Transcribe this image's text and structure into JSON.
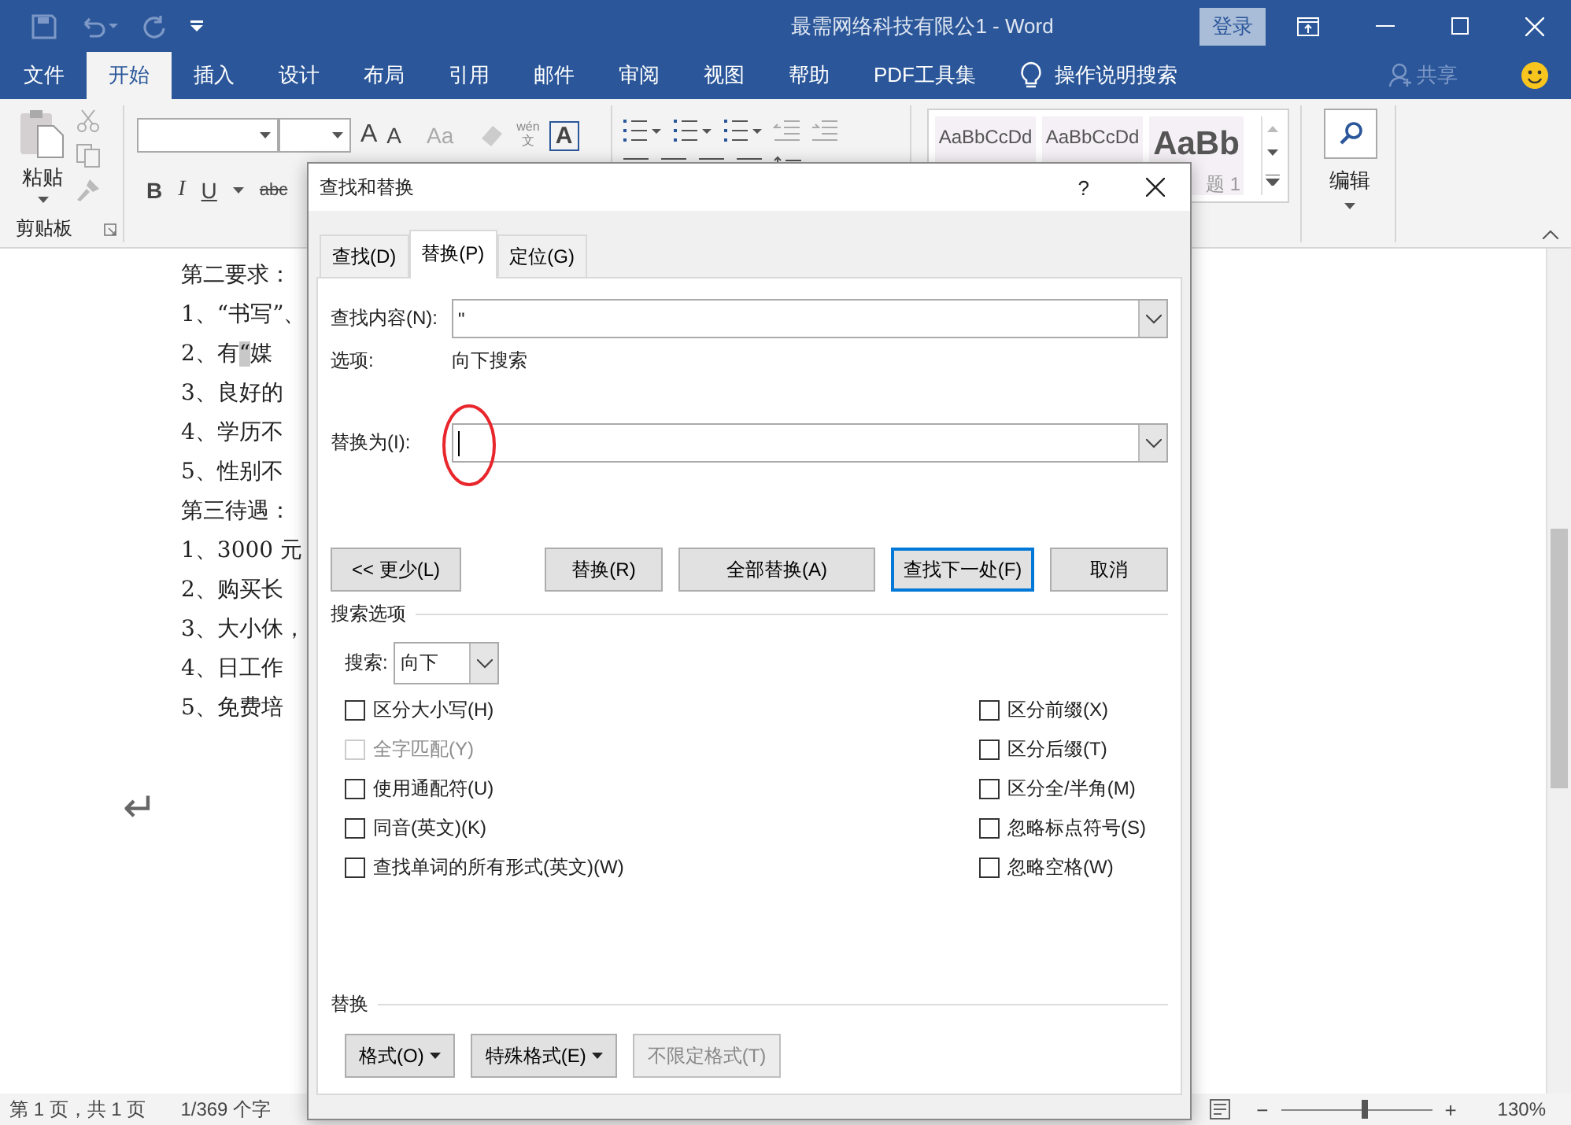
{
  "window": {
    "title": "最需网络科技有限公1 - Word",
    "sign_in": "登录"
  },
  "ribbon_tabs": [
    {
      "label": "文件",
      "selected": false
    },
    {
      "label": "开始",
      "selected": true
    },
    {
      "label": "插入",
      "selected": false
    },
    {
      "label": "设计",
      "selected": false
    },
    {
      "label": "布局",
      "selected": false
    },
    {
      "label": "引用",
      "selected": false
    },
    {
      "label": "邮件",
      "selected": false
    },
    {
      "label": "审阅",
      "selected": false
    },
    {
      "label": "视图",
      "selected": false
    },
    {
      "label": "帮助",
      "selected": false
    },
    {
      "label": "PDF工具集",
      "selected": false
    }
  ],
  "tell_me": "操作说明搜索",
  "share": "共享",
  "ribbon": {
    "clipboard": {
      "paste": "粘贴",
      "group_label": "剪贴板"
    },
    "font": {
      "grow": "A",
      "shrink": "A",
      "case": "Aa",
      "phonetic_top": "wén",
      "phonetic_bottom": "文",
      "border_char": "A",
      "bold": "B",
      "italic": "I",
      "underline": "U",
      "strike": "abc"
    },
    "styles": [
      {
        "sample": "AaBbCcDd",
        "kind": "normal"
      },
      {
        "sample": "AaBbCcDd",
        "kind": "normal"
      },
      {
        "sample": "AaBb",
        "kind": "heading",
        "caption": "题 1"
      }
    ],
    "editing": "编辑"
  },
  "document": {
    "lines": [
      {
        "text": "第二要求："
      },
      {
        "text": "1、“书写”、"
      },
      {
        "text": "2、有",
        "selected_text": "“",
        "after": "媒"
      },
      {
        "text": "3、良好的"
      },
      {
        "text": "4、学历不"
      },
      {
        "text": "5、性别不"
      },
      {
        "text": "第三待遇："
      },
      {
        "text": "1、3000 元"
      },
      {
        "text": "2、购买长"
      },
      {
        "text": "3、大小休，"
      },
      {
        "text": "4、日工作"
      },
      {
        "text": "5、免费培"
      }
    ],
    "return_mark": "↵"
  },
  "dialog": {
    "title": "查找和替换",
    "help": "?",
    "tabs": [
      {
        "label": "查找(D)",
        "selected": false
      },
      {
        "label": "替换(P)",
        "selected": true
      },
      {
        "label": "定位(G)",
        "selected": false
      }
    ],
    "find": {
      "label": "查找内容(N):",
      "value": "\""
    },
    "options": {
      "label": "选项:",
      "value": "向下搜索"
    },
    "replace": {
      "label": "替换为(I):",
      "focused": true,
      "annotated": true
    },
    "buttons": [
      {
        "label": "<< 更少(L)",
        "default": false
      },
      {
        "label": "替换(R)",
        "default": false
      },
      {
        "label": "全部替换(A)",
        "default": false
      },
      {
        "label": "查找下一处(F)",
        "default": true
      },
      {
        "label": "取消",
        "default": false
      }
    ],
    "search_options_title": "搜索选项",
    "search": {
      "label": "搜索:",
      "value": "向下"
    },
    "left_options": [
      {
        "label": "区分大小写(H)",
        "checked": false,
        "disabled": false
      },
      {
        "label": "全字匹配(Y)",
        "checked": false,
        "disabled": true
      },
      {
        "label": "使用通配符(U)",
        "checked": false,
        "disabled": false
      },
      {
        "label": "同音(英文)(K)",
        "checked": false,
        "disabled": false
      },
      {
        "label": "查找单词的所有形式(英文)(W)",
        "checked": false,
        "disabled": false
      }
    ],
    "right_options": [
      {
        "label": "区分前缀(X)",
        "checked": false,
        "disabled": false
      },
      {
        "label": "区分后缀(T)",
        "checked": false,
        "disabled": false
      },
      {
        "label": "区分全/半角(M)",
        "checked": false,
        "disabled": false
      },
      {
        "label": "忽略标点符号(S)",
        "checked": false,
        "disabled": false
      },
      {
        "label": "忽略空格(W)",
        "checked": false,
        "disabled": false
      }
    ],
    "replace_section": {
      "title": "替换",
      "buttons": [
        {
          "label": "格式(O)",
          "dropdown": true,
          "disabled": false
        },
        {
          "label": "特殊格式(E)",
          "dropdown": true,
          "disabled": false
        },
        {
          "label": "不限定格式(T)",
          "dropdown": false,
          "disabled": true
        }
      ]
    }
  },
  "status_bar": {
    "page": "第 1 页，共 1 页",
    "words": "1/369 个字",
    "zoom_out": "−",
    "zoom_in": "+",
    "zoom": {
      "level": 0.55,
      "reading": "130%"
    }
  }
}
